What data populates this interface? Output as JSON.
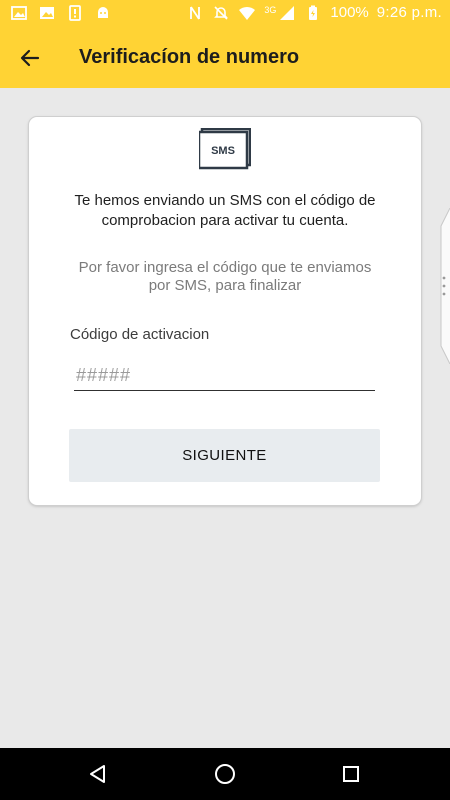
{
  "status_bar": {
    "battery_percent": "100%",
    "time": "9:26 p.m.",
    "network_label": "3G",
    "left_icons": [
      "image-icon",
      "photo-icon",
      "alert-icon",
      "android-icon"
    ],
    "right_icons": [
      "nfc-icon",
      "mute-icon",
      "wifi-icon",
      "signal-icon",
      "battery-icon"
    ]
  },
  "app_bar": {
    "title": "Verificacíon de numero",
    "background_color": "#ffd334",
    "back_icon": "arrow-left-icon"
  },
  "card": {
    "icon_label": "SMS",
    "message_line1": "Te hemos enviando un SMS con el código de",
    "message_line2": "comprobacion para activar tu cuenta.",
    "hint_line1": "Por favor ingresa el código que te enviamos",
    "hint_line2": "por SMS, para finalizar",
    "field_label": "Código de activacion",
    "code_placeholder": "#####",
    "code_value": "",
    "next_button_label": "SIGUIENTE"
  },
  "nav_bar": {
    "icons": [
      "back-triangle-icon",
      "home-circle-icon",
      "recents-square-icon"
    ]
  }
}
